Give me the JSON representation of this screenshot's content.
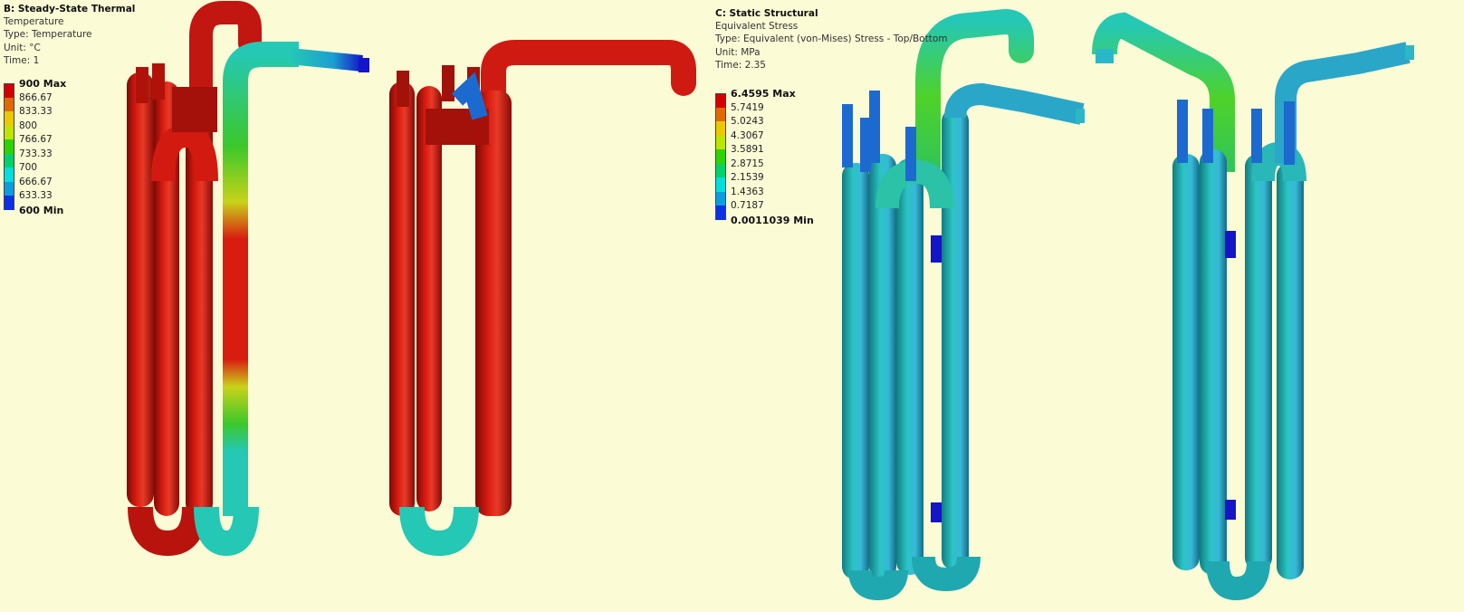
{
  "thermal": {
    "title": "B: Steady-State Thermal",
    "result": "Temperature",
    "type_line": "Type: Temperature",
    "unit_line": "Unit: °C",
    "time_line": "Time: 1",
    "legend": [
      {
        "label": "900 Max",
        "color": "#d40000",
        "bold": true
      },
      {
        "label": "866.67",
        "color": "#e06a00",
        "bold": false
      },
      {
        "label": "833.33",
        "color": "#ecc800",
        "bold": false
      },
      {
        "label": "800",
        "color": "#bce600",
        "bold": false
      },
      {
        "label": "766.67",
        "color": "#2ed400",
        "bold": false
      },
      {
        "label": "733.33",
        "color": "#00d26a",
        "bold": false
      },
      {
        "label": "700",
        "color": "#00dede",
        "bold": false
      },
      {
        "label": "666.67",
        "color": "#0a9ee0",
        "bold": false
      },
      {
        "label": "633.33",
        "color": "#0b30e8",
        "bold": false
      },
      {
        "label": "600 Min",
        "color": null,
        "bold": true
      }
    ]
  },
  "structural": {
    "title": "C: Static Structural",
    "result": "Equivalent Stress",
    "type_line": "Type: Equivalent (von-Mises) Stress - Top/Bottom",
    "unit_line": "Unit: MPa",
    "time_line": "Time: 2.35",
    "legend": [
      {
        "label": "6.4595 Max",
        "color": "#d40000",
        "bold": true
      },
      {
        "label": "5.7419",
        "color": "#e06a00",
        "bold": false
      },
      {
        "label": "5.0243",
        "color": "#ecc800",
        "bold": false
      },
      {
        "label": "4.3067",
        "color": "#bce600",
        "bold": false
      },
      {
        "label": "3.5891",
        "color": "#2ed400",
        "bold": false
      },
      {
        "label": "2.8715",
        "color": "#00d26a",
        "bold": false
      },
      {
        "label": "2.1539",
        "color": "#00dede",
        "bold": false
      },
      {
        "label": "1.4363",
        "color": "#0a9ee0",
        "bold": false
      },
      {
        "label": "0.7187",
        "color": "#0b30e8",
        "bold": false
      },
      {
        "label": "0.0011039 Min",
        "color": null,
        "bold": true
      }
    ]
  },
  "colors": {
    "background": "#fbfbd6",
    "hot": "#cf1a12",
    "hot_dark": "#8a0c06",
    "cool": "#25c8b4",
    "cool_dark": "#16867a",
    "warm": "#c9d21a",
    "green": "#3cc82a",
    "steel_blue": "#1c9fd0",
    "deep_blue": "#1414c8"
  }
}
